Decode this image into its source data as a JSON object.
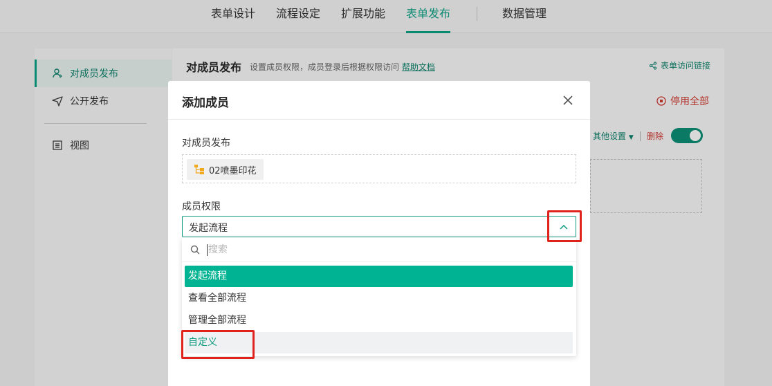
{
  "topnav": {
    "tabs": [
      {
        "label": "表单设计"
      },
      {
        "label": "流程设定"
      },
      {
        "label": "扩展功能"
      },
      {
        "label": "表单发布"
      },
      {
        "label": "数据管理"
      }
    ],
    "active_tab": "表单发布"
  },
  "sidebar": {
    "items": [
      {
        "label": "对成员发布",
        "icon": "user-share-icon",
        "active": true
      },
      {
        "label": "公开发布",
        "icon": "send-icon",
        "active": false
      },
      {
        "label": "视图",
        "icon": "list-view-icon",
        "active": false
      }
    ]
  },
  "main": {
    "title": "对成员发布",
    "subtitle": "设置成员权限，成员登录后根据权限访问",
    "help_link": "帮助文档",
    "access_link": "表单访问链接",
    "disable_all": "停用全部",
    "other_settings": "其他设置",
    "delete": "删除"
  },
  "modal": {
    "title": "添加成员",
    "publish_label": "对成员发布",
    "member_chip": "02喷墨印花",
    "permission_label": "成员权限",
    "permission_value": "发起流程",
    "search_placeholder": "搜索",
    "options": [
      {
        "label": "发起流程",
        "state": "selected"
      },
      {
        "label": "查看全部流程",
        "state": "normal"
      },
      {
        "label": "管理全部流程",
        "state": "normal"
      },
      {
        "label": "自定义",
        "state": "hover"
      }
    ]
  },
  "colors": {
    "accent": "#00b393",
    "accent_dark": "#0b8a72",
    "danger": "#b3302a",
    "annotation": "#e0221c"
  }
}
